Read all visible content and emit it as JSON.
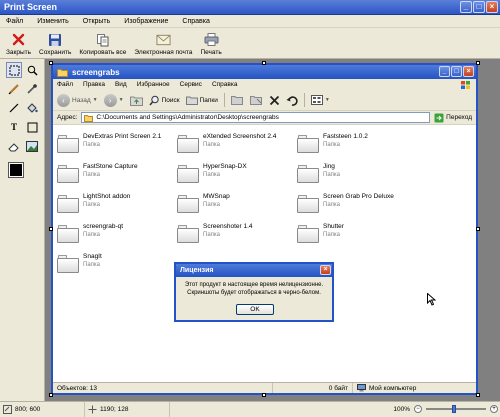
{
  "app": {
    "title": "Print Screen",
    "menu": [
      "Файл",
      "Изменить",
      "Открыть",
      "Изображение",
      "Справка"
    ],
    "toolbar": {
      "close": "Закрыть",
      "save": "Сохранить",
      "copy_all": "Копировать все",
      "email": "Электронная почта",
      "print": "Печать"
    },
    "status": {
      "size": "800; 600",
      "cursor": "1190; 128",
      "zoom": "100%"
    }
  },
  "explorer": {
    "title": "screengrabs",
    "menu": [
      "Файл",
      "Правка",
      "Вид",
      "Избранное",
      "Сервис",
      "Справка"
    ],
    "nav": {
      "back": "Назад",
      "search": "Поиск",
      "folders": "Папки"
    },
    "address": {
      "label": "Адрес:",
      "path": "C:\\Documents and Settings\\Administrator\\Desktop\\screengrabs",
      "go": "Переход"
    },
    "folder_type": "Папка",
    "folders": [
      "DevExtras Print Screen 2.1",
      "eXtended Screenshot 2.4",
      "Faststeen 1.0.2",
      "FastStone Capture",
      "HyperSnap-DX",
      "Jing",
      "LightShot addon",
      "MWSnap",
      "Screen Grab Pro Deluxe",
      "screengrab-qt",
      "Screenshoter 1.4",
      "Shutter",
      "SnagIt"
    ],
    "status": {
      "objects": "Объектов: 13",
      "bytes": "0 байт",
      "computer": "Мой компьютер"
    }
  },
  "dialog": {
    "title": "Лицензия",
    "message": "Этот продукт в настоящее время нелицензионне. Скриншоты будет отображаться в черно-белом.",
    "ok": "OK"
  }
}
